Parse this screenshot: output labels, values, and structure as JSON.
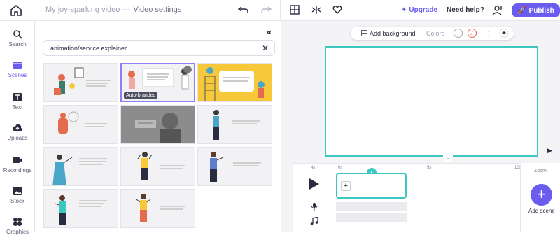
{
  "topbar": {
    "project_title": "My joy-sparking video",
    "separator": "—",
    "video_settings": "Video settings",
    "upgrade": "Upgrade",
    "help": "Need help?",
    "publish": "Publish"
  },
  "nav": {
    "items": [
      {
        "label": "Search",
        "icon": "search-icon"
      },
      {
        "label": "Scenes",
        "icon": "scenes-icon",
        "active": true
      },
      {
        "label": "Text",
        "icon": "text-icon"
      },
      {
        "label": "Uploads",
        "icon": "upload-icon"
      },
      {
        "label": "Recordings",
        "icon": "camera-icon"
      },
      {
        "label": "Stock",
        "icon": "stock-icon"
      },
      {
        "label": "Graphics",
        "icon": "graphics-icon"
      }
    ]
  },
  "panel": {
    "collapse": "«",
    "search_value": "animation/service explainer",
    "clear": "✕",
    "auto_branded": "Auto-branded"
  },
  "canvas_toolbar": {
    "add_background": "Add background",
    "colors": "Colors",
    "more": "⋮"
  },
  "timeline": {
    "time_left": "4s",
    "marks": [
      "0s",
      "5s",
      "10s"
    ],
    "scene_plus": "+"
  },
  "zoom": {
    "label": "Zoom",
    "add_scene": "Add scene",
    "add_symbol": "+"
  },
  "colors": {
    "accent": "#6b5cf0",
    "teal": "#3cc7c1",
    "yellow": "#f7c93a"
  }
}
